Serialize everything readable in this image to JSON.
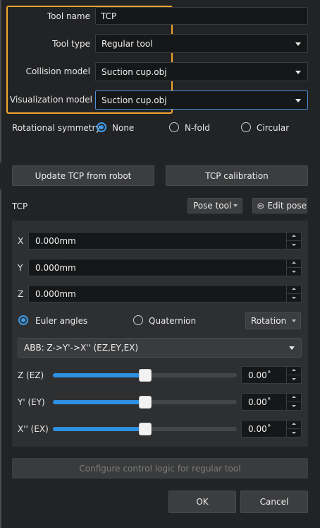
{
  "tool": {
    "name_label": "Tool name",
    "name_value": "TCP",
    "type_label": "Tool type",
    "type_value": "Regular tool",
    "collision_label": "Collision model",
    "collision_value": "Suction cup.obj",
    "visualization_label": "Visualization model",
    "visualization_value": "Suction cup.obj"
  },
  "symmetry": {
    "label": "Rotational symmetry",
    "options": [
      "None",
      "N-fold",
      "Circular"
    ],
    "selected": "None"
  },
  "actions": {
    "update_tcp": "Update TCP from robot",
    "calibration": "TCP calibration"
  },
  "tcp": {
    "label": "TCP",
    "pose_tool": "Pose tool",
    "edit_pose": "Edit pose",
    "x_label": "X",
    "x_value": "0.000mm",
    "y_label": "Y",
    "y_value": "0.000mm",
    "z_label": "Z",
    "z_value": "0.000mm",
    "euler_label": "Euler angles",
    "quaternion_label": "Quaternion",
    "orientation_mode": "Euler angles",
    "rotation_label": "Rotation",
    "convention": "ABB: Z->Y'->X'' (EZ,EY,EX)",
    "angles": [
      {
        "label": "Z (EZ)",
        "value_text": "0.00˚",
        "slider_fraction": 0.5
      },
      {
        "label": "Y' (EY)",
        "value_text": "0.00˚",
        "slider_fraction": 0.5
      },
      {
        "label": "X'' (EX)",
        "value_text": "0.00˚",
        "slider_fraction": 0.5
      }
    ]
  },
  "footer": {
    "configure": "Configure control logic for regular tool",
    "ok": "OK",
    "cancel": "Cancel"
  },
  "colors": {
    "accent": "#2f8fe0",
    "highlight": "#f0a52e",
    "background": "#222325"
  }
}
